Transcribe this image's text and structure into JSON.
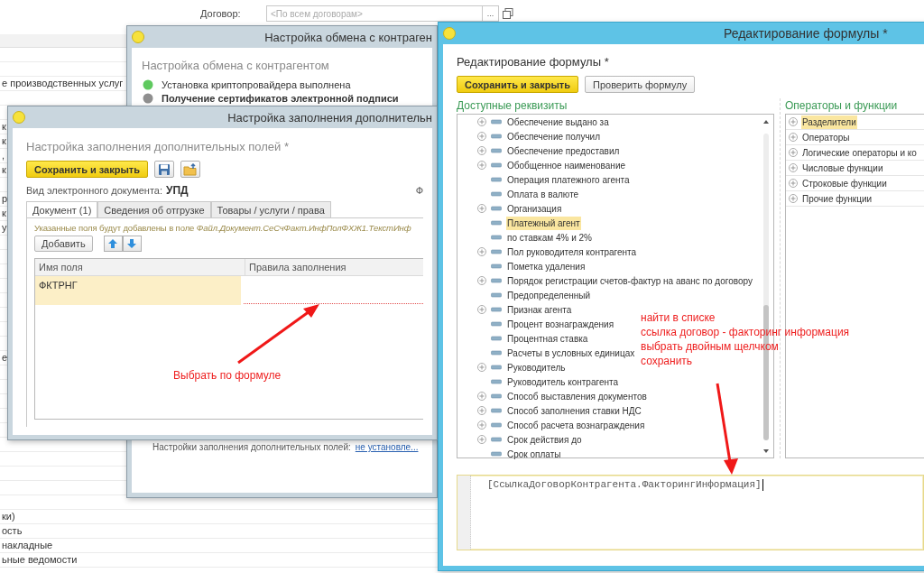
{
  "background_app": {
    "contract_label": "Договор:",
    "contract_field": {
      "placeholder": "<По всем договорам>"
    },
    "contract_select_button": "...",
    "list_rows": [
      {},
      {},
      {
        "text": "е производственных услуг"
      },
      {},
      {},
      {
        "text": "к"
      },
      {
        "text": "к"
      },
      {
        "text": ","
      },
      {
        "text": "к"
      },
      {},
      {
        "text": "р"
      },
      {
        "text": "к"
      },
      {
        "text": "у"
      },
      {},
      {},
      {},
      {},
      {},
      {},
      {},
      {},
      {
        "text": "е"
      },
      {},
      {},
      {},
      {},
      {},
      {},
      {},
      {},
      {},
      {},
      {
        "text": "ки)"
      },
      {
        "text": "ость"
      },
      {
        "text": "накладные"
      },
      {
        "text": "ьные ведомости"
      }
    ]
  },
  "exchange_window": {
    "title": "Настройка обмена с контраген",
    "heading": "Настройка обмена с контрагентом",
    "steps": [
      {
        "text": "Установка криптопровайдера выполнена",
        "color": "#5fc95f"
      },
      {
        "text": "Получение сертификатов электронной подписи",
        "color": "#8f8f8f"
      }
    ],
    "fields_setting_label": "Настройки заполнения дополнительных полей:",
    "fields_setting_link": "не установле..."
  },
  "fields_window": {
    "title": "Настройка заполнения дополнительн",
    "heading": "Настройка заполнения дополнительных полей *",
    "save_button": "Сохранить и закрыть",
    "doc_type_label": "Вид электронного документа:",
    "doc_type_value": "УПД",
    "cut_label": "Ф",
    "tabs": [
      {
        "label": "Документ (1)",
        "selected": true
      },
      {
        "label": "Сведения об отгрузке",
        "selected": false
      },
      {
        "label": "Товары / услуги / права",
        "selected": false
      }
    ],
    "hint": "Указанные поля будут добавлены в поле *Файл.Документ.СеСчФакт.ИнфПолФХЖ1.ТекстИнф*",
    "add_button": "Добавить",
    "table": {
      "columns": [
        "Имя поля",
        "Правила заполнения"
      ],
      "rows": [
        {
          "field_name": "ФКТРНГ",
          "selected": true,
          "rule_required_empty": true
        }
      ]
    }
  },
  "formula_window": {
    "title": "Редактирование формулы *",
    "heading": "Редактирование формулы *",
    "save_button": "Сохранить и закрыть",
    "check_button": "Проверить формулу",
    "attributes_title": "Доступные реквизиты",
    "attributes": [
      {
        "label": "Обеспечение выдано за",
        "expandable": true,
        "selected": false
      },
      {
        "label": "Обеспечение получил",
        "expandable": true,
        "selected": false
      },
      {
        "label": "Обеспечение предоставил",
        "expandable": true,
        "selected": false
      },
      {
        "label": "Обобщенное наименование",
        "expandable": true,
        "selected": false
      },
      {
        "label": "Операция платежного агента",
        "expandable": false,
        "selected": false
      },
      {
        "label": "Оплата в валюте",
        "expandable": false,
        "selected": false
      },
      {
        "label": "Организация",
        "expandable": true,
        "selected": false
      },
      {
        "label": "Платежный агент",
        "expandable": false,
        "selected": true
      },
      {
        "label": "по ставкам 4% и 2%",
        "expandable": false,
        "selected": false
      },
      {
        "label": "Пол руководителя контрагента",
        "expandable": true,
        "selected": false
      },
      {
        "label": "Пометка удаления",
        "expandable": false,
        "selected": false
      },
      {
        "label": "Порядок регистрации счетов-фактур на аванс по договору",
        "expandable": true,
        "selected": false
      },
      {
        "label": "Предопределенный",
        "expandable": false,
        "selected": false
      },
      {
        "label": "Признак агента",
        "expandable": true,
        "selected": false
      },
      {
        "label": "Процент вознаграждения",
        "expandable": false,
        "selected": false
      },
      {
        "label": "Процентная ставка",
        "expandable": false,
        "selected": false
      },
      {
        "label": "Расчеты в условных единицах",
        "expandable": false,
        "selected": false
      },
      {
        "label": "Руководитель",
        "expandable": true,
        "selected": false
      },
      {
        "label": "Руководитель контрагента",
        "expandable": false,
        "selected": false
      },
      {
        "label": "Способ выставления документов",
        "expandable": true,
        "selected": false
      },
      {
        "label": "Способ заполнения ставки НДС",
        "expandable": true,
        "selected": false
      },
      {
        "label": "Способ расчета вознаграждения",
        "expandable": true,
        "selected": false
      },
      {
        "label": "Срок действия до",
        "expandable": true,
        "selected": false
      },
      {
        "label": "Срок оплаты",
        "expandable": false,
        "selected": false
      }
    ],
    "functions_title": "Операторы и функции",
    "functions": [
      {
        "label": "Разделители",
        "selected": true
      },
      {
        "label": "Операторы",
        "selected": false
      },
      {
        "label": "Логические операторы и ко",
        "selected": false
      },
      {
        "label": "Числовые функции",
        "selected": false
      },
      {
        "label": "Строковые функции",
        "selected": false
      },
      {
        "label": "Прочие функции",
        "selected": false
      }
    ],
    "formula": "[СсылкаДоговорКонтрагента.ФакторингИнформация]"
  },
  "annotations": [
    {
      "text": "Выбрать по формуле"
    },
    {
      "text": "найти в списке\nссылка договор - факторинг информация\nвыбрать двойным щелчком\nсохранить"
    }
  ]
}
